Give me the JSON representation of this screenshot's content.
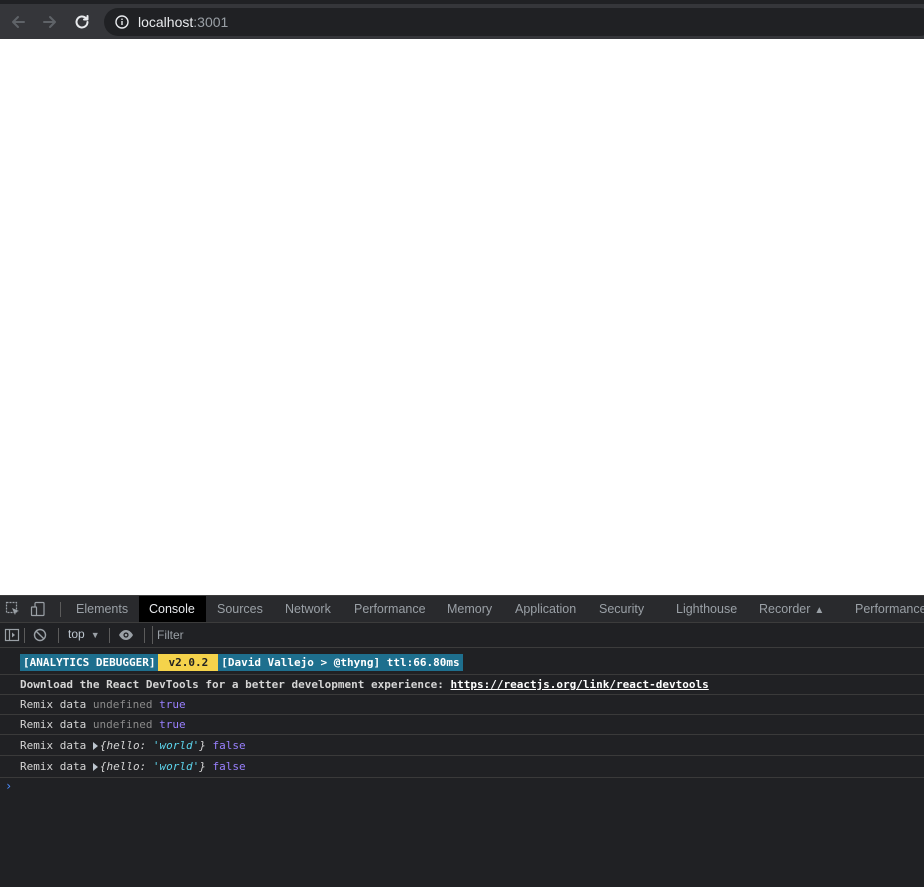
{
  "browser": {
    "url_host": "localhost",
    "url_port": ":3001"
  },
  "devtools": {
    "tabs": [
      {
        "label": "Elements",
        "active": false
      },
      {
        "label": "Console",
        "active": true
      },
      {
        "label": "Sources",
        "active": false
      },
      {
        "label": "Network",
        "active": false
      },
      {
        "label": "Performance",
        "active": false
      },
      {
        "label": "Memory",
        "active": false
      },
      {
        "label": "Application",
        "active": false
      },
      {
        "label": "Security",
        "active": false
      },
      {
        "label": "Lighthouse",
        "active": false
      },
      {
        "label": "Recorder",
        "active": false
      },
      {
        "label": "Performance",
        "active": false
      }
    ],
    "console_toolbar": {
      "context": "top",
      "filter_placeholder": "Filter"
    },
    "messages": {
      "analytics_badge": "[ANALYTICS DEBUGGER]",
      "version_badge": "v2.0.2",
      "author_badge": "[David Vallejo > @thyng] ttl:66.80ms",
      "react_text": "Download the React DevTools for a better development experience: ",
      "react_link": "https://reactjs.org/link/react-devtools",
      "log1": {
        "label": "Remix data",
        "value": "undefined",
        "flag": "true"
      },
      "log2": {
        "label": "Remix data",
        "value": "undefined",
        "flag": "true"
      },
      "log3": {
        "label": "Remix data",
        "obj_open": "{",
        "obj_key": "hello",
        "obj_colon": ": ",
        "obj_val": "'world'",
        "obj_close": "}",
        "flag": "false"
      },
      "log4": {
        "label": "Remix data",
        "obj_open": "{",
        "obj_key": "hello",
        "obj_colon": ": ",
        "obj_val": "'world'",
        "obj_close": "}",
        "flag": "false"
      }
    }
  }
}
